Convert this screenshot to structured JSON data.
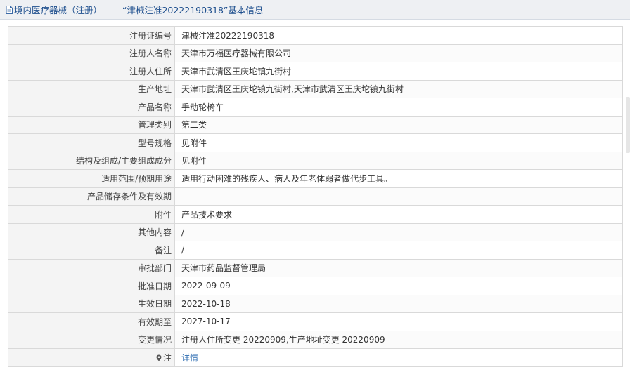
{
  "header": {
    "title": "境内医疗器械（注册） ——“津械注准20222190318”基本信息"
  },
  "rows": [
    {
      "label": "注册证编号",
      "value": "津械注准20222190318"
    },
    {
      "label": "注册人名称",
      "value": "天津市万福医疗器械有限公司"
    },
    {
      "label": "注册人住所",
      "value": "天津市武清区王庆坨镇九街村"
    },
    {
      "label": "生产地址",
      "value": "天津市武清区王庆坨镇九街村,天津市武清区王庆坨镇九街村"
    },
    {
      "label": "产品名称",
      "value": "手动轮椅车"
    },
    {
      "label": "管理类别",
      "value": "第二类"
    },
    {
      "label": "型号规格",
      "value": "见附件"
    },
    {
      "label": "结构及组成/主要组成成分",
      "value": "见附件"
    },
    {
      "label": "适用范围/预期用途",
      "value": "适用行动困难的残疾人、病人及年老体弱者做代步工具。"
    },
    {
      "label": "产品储存条件及有效期",
      "value": ""
    },
    {
      "label": "附件",
      "value": "产品技术要求"
    },
    {
      "label": "其他内容",
      "value": "/"
    },
    {
      "label": "备注",
      "value": "/"
    },
    {
      "label": "审批部门",
      "value": "天津市药品监督管理局"
    },
    {
      "label": "批准日期",
      "value": "2022-09-09"
    },
    {
      "label": "生效日期",
      "value": "2022-10-18"
    },
    {
      "label": "有效期至",
      "value": "2027-10-17"
    },
    {
      "label": "变更情况",
      "value": "注册人住所变更 20220909,生产地址变更 20220909"
    }
  ],
  "note": {
    "label": "注",
    "link_text": "详情",
    "icon": "map-pin-icon"
  },
  "colors": {
    "header_bg": "#eef0f3",
    "title": "#1e4f8e",
    "label_bg": "#f4f4f4",
    "border": "#d9d9d9",
    "link": "#2a6ab0"
  }
}
